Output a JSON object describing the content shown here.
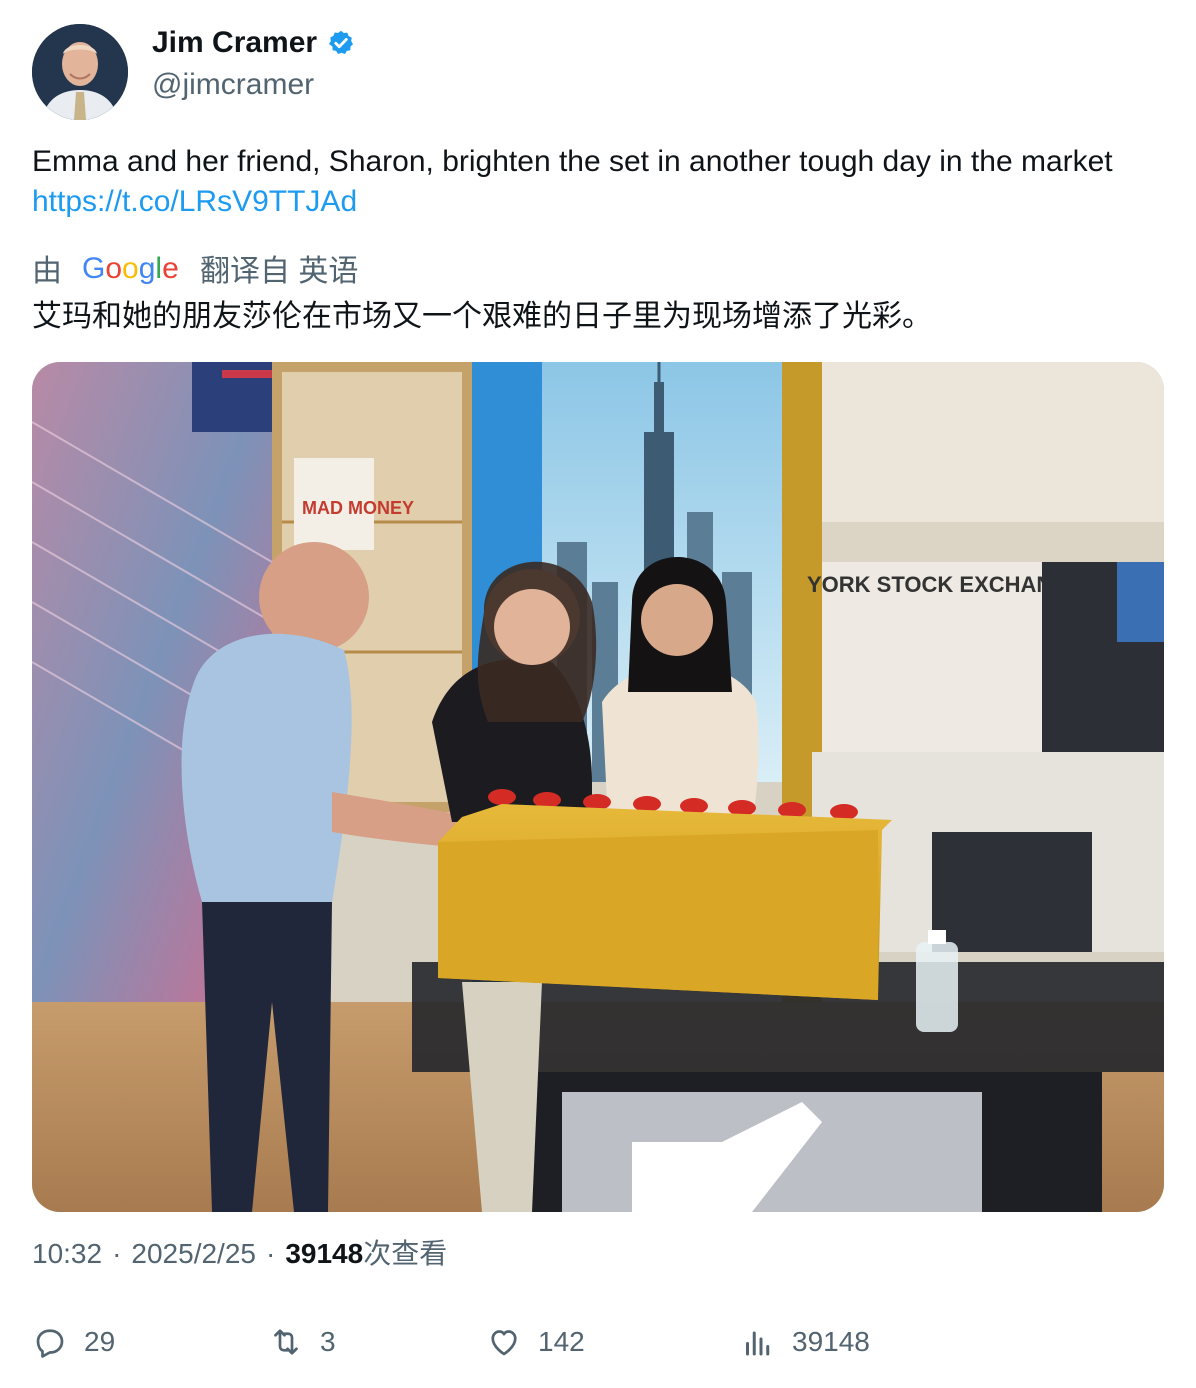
{
  "author": {
    "display_name": "Jim Cramer",
    "handle": "@jimcramer",
    "verified": true
  },
  "tweet": {
    "text": "Emma and her friend, Sharon, brighten the set in another tough day in the market ",
    "link": "https://t.co/LRsV9TTJAd"
  },
  "translation": {
    "prefix": "由",
    "provider": "Google",
    "suffix": "翻译自 英语",
    "text": "艾玛和她的朋友莎伦在市场又一个艰难的日子里为现场增添了光彩。"
  },
  "media": {
    "signage_text": "YORK STOCK EXCHANGE",
    "logo_text": "MAD MONEY"
  },
  "meta": {
    "time": "10:32",
    "date": "2025/2/25",
    "views_count": "39148",
    "views_label": "次查看"
  },
  "actions": {
    "replies": "29",
    "retweets": "3",
    "likes": "142",
    "views": "39148"
  },
  "colors": {
    "link": "#1d9bf0",
    "secondary": "#536471",
    "primary": "#0f1419",
    "verified": "#1d9bf0"
  }
}
